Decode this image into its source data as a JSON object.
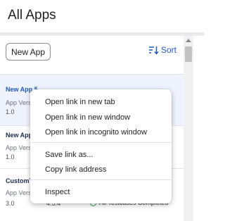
{
  "header": {
    "title": "All Apps"
  },
  "toolbar": {
    "new_app_label": "New App",
    "sort_label": "Sort"
  },
  "apps": [
    {
      "name": "New App 5",
      "version_label": "App Versi",
      "version": "1.0",
      "selected": true
    },
    {
      "name": "New App",
      "version_label": "App Versi",
      "version": "1.0",
      "selected": false
    },
    {
      "name": "CustomT",
      "version_label": "App Versi",
      "version": "3.0",
      "extra": "4.5.4",
      "status": "All Testcases Completed",
      "selected": false
    }
  ],
  "context_menu": {
    "items": [
      "Open link in new tab",
      "Open link in new window",
      "Open link in incognito window",
      "Save link as...",
      "Copy link address",
      "Inspect"
    ]
  },
  "colors": {
    "accent": "#2157c7",
    "status_ok": "#2e9d52",
    "selected_row": "#eef3fd",
    "band": "#e9ebee"
  },
  "icons": {
    "sort": "sort-icon",
    "status": "check-circle-icon"
  }
}
